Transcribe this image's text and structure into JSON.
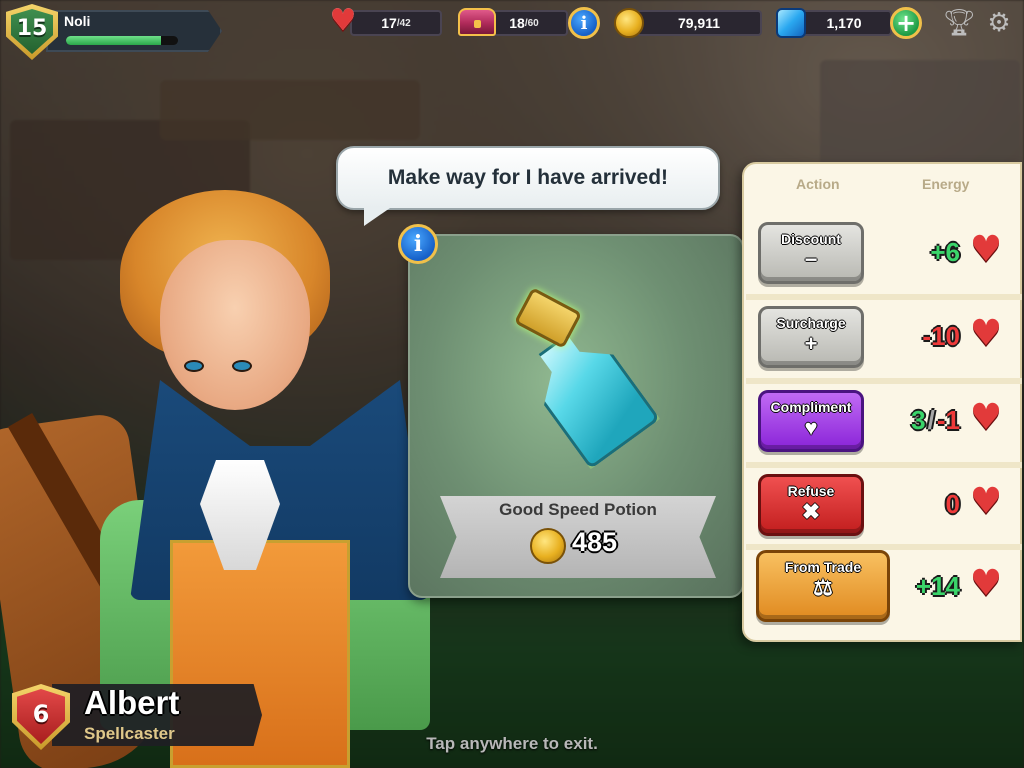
{
  "player": {
    "level": "15",
    "name": "Noli",
    "xp_progress": 0.85
  },
  "resources": {
    "energy": {
      "current": "17",
      "max": "/42"
    },
    "storage": {
      "current": "18",
      "max": "/60"
    },
    "gold": "79,911",
    "gems": "1,170"
  },
  "speech": "Make way for I have arrived!",
  "item": {
    "name": "Good Speed Potion",
    "price": "485"
  },
  "actions_header": {
    "action": "Action",
    "energy": "Energy"
  },
  "actions": [
    {
      "label": "Discount",
      "symbol": "−",
      "energy_a": "+6",
      "energy_b": ""
    },
    {
      "label": "Surcharge",
      "symbol": "+",
      "energy_a": "-10",
      "energy_b": ""
    },
    {
      "label": "Compliment",
      "symbol": "♥",
      "energy_a": "3",
      "energy_b": "-1"
    },
    {
      "label": "Refuse",
      "symbol": "✖",
      "energy_a": "0",
      "energy_b": ""
    },
    {
      "label": "From Trade",
      "symbol": "⚖",
      "energy_a": "+14",
      "energy_b": ""
    }
  ],
  "customer": {
    "level": "6",
    "name": "Albert",
    "class": "Spellcaster"
  },
  "exit_hint": "Tap anywhere to exit.",
  "colors": {
    "positive": "#3ad46a",
    "negative": "#ee3a3a",
    "accent_gold": "#f0c04a"
  },
  "icons": [
    "heart-icon",
    "chest-icon",
    "info-icon",
    "coin-icon",
    "gem-icon",
    "plus-icon",
    "trophy-icon",
    "gear-icon",
    "potion-icon",
    "scales-icon"
  ]
}
